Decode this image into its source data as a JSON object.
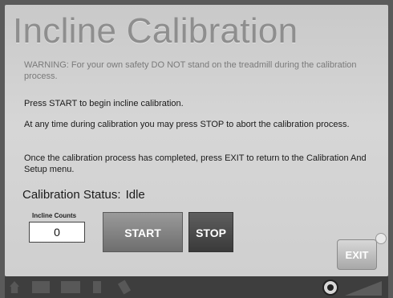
{
  "header": {
    "title": "Incline Calibration"
  },
  "messages": {
    "warning": "WARNING:  For your own safety DO NOT stand on the treadmill during the calibration process.",
    "start_instruction": "Press START to begin incline calibration.",
    "stop_instruction": "At any time during calibration you may press STOP to abort the calibration process.",
    "exit_instruction": "Once the calibration process has completed, press EXIT to return to the Calibration And Setup menu."
  },
  "status": {
    "label": "Calibration Status:",
    "value": "Idle"
  },
  "incline_counts": {
    "label": "Incline Counts",
    "value": "0"
  },
  "buttons": {
    "start": "START",
    "stop": "STOP",
    "exit": "EXIT"
  },
  "bottom_bar": {
    "icons": [
      "home-icon",
      "keypad-icon",
      "screen-icon",
      "phone-icon",
      "key-icon",
      "speaker-icon",
      "volume-ramp-icon"
    ]
  }
}
